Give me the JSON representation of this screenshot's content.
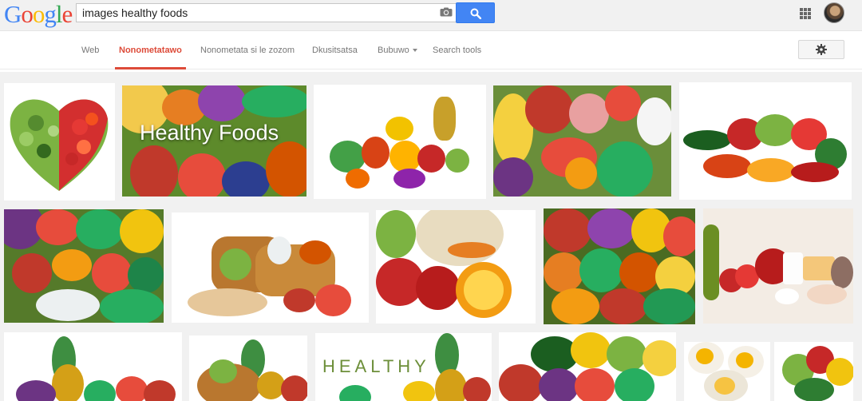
{
  "header": {
    "logo_letters": [
      {
        "ch": "G",
        "color": "#4285f4"
      },
      {
        "ch": "o",
        "color": "#ea4335"
      },
      {
        "ch": "o",
        "color": "#fbbc05"
      },
      {
        "ch": "g",
        "color": "#4285f4"
      },
      {
        "ch": "l",
        "color": "#34a853"
      },
      {
        "ch": "e",
        "color": "#ea4335"
      }
    ],
    "search_query": "images healthy foods",
    "camera_icon": "camera-icon",
    "search_icon": "search-icon",
    "apps_icon": "apps-grid-icon"
  },
  "nav": {
    "tabs": [
      {
        "label": "Web",
        "active": false
      },
      {
        "label": "Nonometatawo",
        "active": true
      },
      {
        "label": "Nonometata si le zozom",
        "active": false
      },
      {
        "label": "Dkusitsatsa",
        "active": false
      },
      {
        "label": "Bubuwo",
        "active": false,
        "dropdown": true
      },
      {
        "label": "Search tools",
        "active": false
      }
    ],
    "settings_icon": "gear-icon",
    "active_color": "#dd4b39"
  },
  "results": {
    "thumbnail_overlays": {
      "healthy_foods": "Healthy Foods",
      "healthy_word": "HEALTHY"
    }
  }
}
